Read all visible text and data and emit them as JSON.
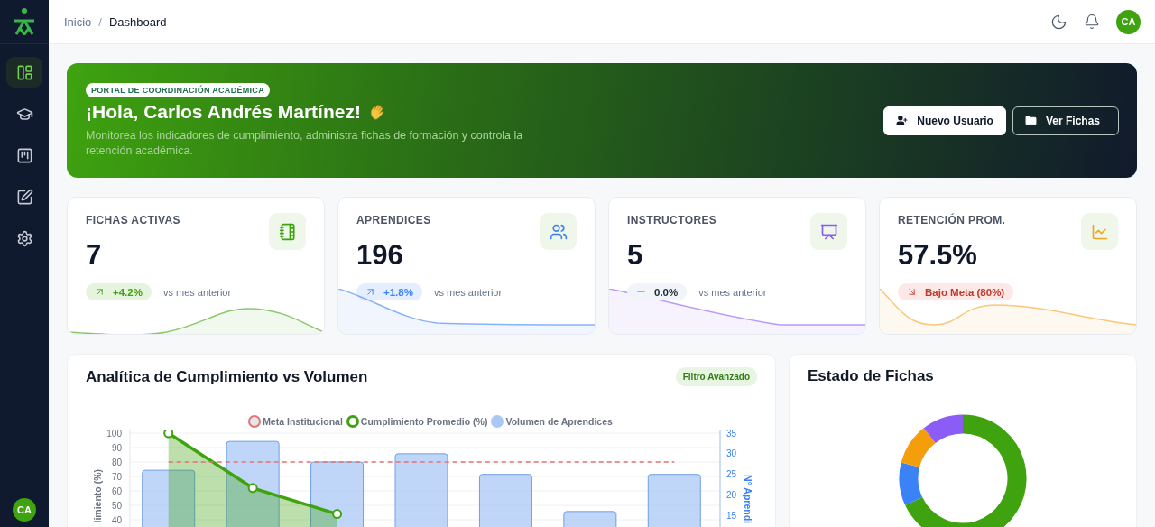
{
  "sidebar": {
    "nav_items": [
      {
        "selected": true
      },
      {
        "selected": false
      },
      {
        "selected": false
      },
      {
        "selected": false
      },
      {
        "selected": false
      }
    ],
    "user_avatar": "CA"
  },
  "header": {
    "breadcrumb": [
      "Inicio",
      "Dashboard"
    ],
    "breadcrumb_separator": "/",
    "user_avatar": "CA"
  },
  "hero": {
    "badge": "PORTAL DE COORDINACIÓN ACADÉMICA",
    "title": "¡Hola, Carlos Andrés Martínez!",
    "subtitle": "Monitorea los indicadores de cumplimiento, administra fichas de formación y controla la retención académica.",
    "buttons": [
      {
        "label": "Nuevo Usuario",
        "kind": "primary"
      },
      {
        "label": "Ver Fichas",
        "kind": "outline"
      }
    ]
  },
  "stats": [
    {
      "label": "FICHAS ACTIVAS",
      "value": "7",
      "kind": "up",
      "change": "+4.2%",
      "note": "vs mes anterior",
      "color": "#3fa30f"
    },
    {
      "label": "APRENDICES",
      "value": "196",
      "kind": "up",
      "change": "+1.8%",
      "note": "vs mes anterior",
      "color": "#3b82f6"
    },
    {
      "label": "INSTRUCTORES",
      "value": "5",
      "kind": "flat",
      "change": "0.0%",
      "note": "vs mes anterior",
      "color": "#8b5cf6"
    },
    {
      "label": "RETENCIÓN PROM.",
      "value": "57.5%",
      "kind": "down",
      "change": "Bajo Meta (80%)",
      "color": "#f5a524"
    }
  ],
  "analytics": {
    "title": "Analítica de Cumplimiento vs Volumen",
    "filter": "Filtro Avanzado",
    "chart_data": {
      "type": "bar",
      "grid": true,
      "legend": "top",
      "ylabel": "limiento (%)",
      "y2label": "N° Aprendi",
      "ylim": [
        0,
        100
      ],
      "y2lim": [
        0,
        35
      ],
      "yticks": [
        40,
        50,
        60,
        70,
        80,
        90,
        100
      ],
      "y2ticks": [
        15,
        20,
        25,
        30,
        35
      ],
      "series": [
        {
          "name": "Meta Institucional",
          "type": "line",
          "line_style": "dashed",
          "color": "#e57373",
          "values": [
            80,
            80,
            80,
            80,
            80,
            80,
            80
          ]
        },
        {
          "name": "Cumplimiento Promedio (%)",
          "type": "area",
          "color": "#3fa30f",
          "values": [
            100,
            62,
            44,
            null,
            null,
            null,
            null
          ]
        },
        {
          "name": "Volumen de Aprendices",
          "type": "bar",
          "axis": "y2",
          "color": "#a9c8f5",
          "values": [
            26,
            33,
            28,
            30,
            25,
            16,
            25
          ]
        }
      ]
    }
  },
  "status": {
    "title": "Estado de Fichas"
  }
}
